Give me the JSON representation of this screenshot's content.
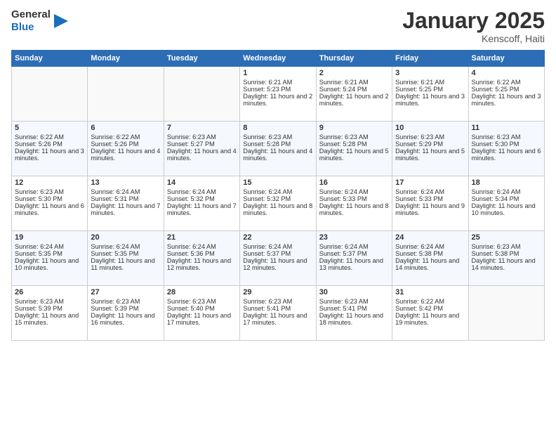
{
  "logo": {
    "general": "General",
    "blue": "Blue"
  },
  "title": "January 2025",
  "location": "Kenscoff, Haiti",
  "days_of_week": [
    "Sunday",
    "Monday",
    "Tuesday",
    "Wednesday",
    "Thursday",
    "Friday",
    "Saturday"
  ],
  "weeks": [
    [
      {
        "day": "",
        "info": ""
      },
      {
        "day": "",
        "info": ""
      },
      {
        "day": "",
        "info": ""
      },
      {
        "day": "1",
        "sunrise": "Sunrise: 6:21 AM",
        "sunset": "Sunset: 5:23 PM",
        "daylight": "Daylight: 11 hours and 2 minutes."
      },
      {
        "day": "2",
        "sunrise": "Sunrise: 6:21 AM",
        "sunset": "Sunset: 5:24 PM",
        "daylight": "Daylight: 11 hours and 2 minutes."
      },
      {
        "day": "3",
        "sunrise": "Sunrise: 6:21 AM",
        "sunset": "Sunset: 5:25 PM",
        "daylight": "Daylight: 11 hours and 3 minutes."
      },
      {
        "day": "4",
        "sunrise": "Sunrise: 6:22 AM",
        "sunset": "Sunset: 5:25 PM",
        "daylight": "Daylight: 11 hours and 3 minutes."
      }
    ],
    [
      {
        "day": "5",
        "sunrise": "Sunrise: 6:22 AM",
        "sunset": "Sunset: 5:26 PM",
        "daylight": "Daylight: 11 hours and 3 minutes."
      },
      {
        "day": "6",
        "sunrise": "Sunrise: 6:22 AM",
        "sunset": "Sunset: 5:26 PM",
        "daylight": "Daylight: 11 hours and 4 minutes."
      },
      {
        "day": "7",
        "sunrise": "Sunrise: 6:23 AM",
        "sunset": "Sunset: 5:27 PM",
        "daylight": "Daylight: 11 hours and 4 minutes."
      },
      {
        "day": "8",
        "sunrise": "Sunrise: 6:23 AM",
        "sunset": "Sunset: 5:28 PM",
        "daylight": "Daylight: 11 hours and 4 minutes."
      },
      {
        "day": "9",
        "sunrise": "Sunrise: 6:23 AM",
        "sunset": "Sunset: 5:28 PM",
        "daylight": "Daylight: 11 hours and 5 minutes."
      },
      {
        "day": "10",
        "sunrise": "Sunrise: 6:23 AM",
        "sunset": "Sunset: 5:29 PM",
        "daylight": "Daylight: 11 hours and 5 minutes."
      },
      {
        "day": "11",
        "sunrise": "Sunrise: 6:23 AM",
        "sunset": "Sunset: 5:30 PM",
        "daylight": "Daylight: 11 hours and 6 minutes."
      }
    ],
    [
      {
        "day": "12",
        "sunrise": "Sunrise: 6:23 AM",
        "sunset": "Sunset: 5:30 PM",
        "daylight": "Daylight: 11 hours and 6 minutes."
      },
      {
        "day": "13",
        "sunrise": "Sunrise: 6:24 AM",
        "sunset": "Sunset: 5:31 PM",
        "daylight": "Daylight: 11 hours and 7 minutes."
      },
      {
        "day": "14",
        "sunrise": "Sunrise: 6:24 AM",
        "sunset": "Sunset: 5:32 PM",
        "daylight": "Daylight: 11 hours and 7 minutes."
      },
      {
        "day": "15",
        "sunrise": "Sunrise: 6:24 AM",
        "sunset": "Sunset: 5:32 PM",
        "daylight": "Daylight: 11 hours and 8 minutes."
      },
      {
        "day": "16",
        "sunrise": "Sunrise: 6:24 AM",
        "sunset": "Sunset: 5:33 PM",
        "daylight": "Daylight: 11 hours and 8 minutes."
      },
      {
        "day": "17",
        "sunrise": "Sunrise: 6:24 AM",
        "sunset": "Sunset: 5:33 PM",
        "daylight": "Daylight: 11 hours and 9 minutes."
      },
      {
        "day": "18",
        "sunrise": "Sunrise: 6:24 AM",
        "sunset": "Sunset: 5:34 PM",
        "daylight": "Daylight: 11 hours and 10 minutes."
      }
    ],
    [
      {
        "day": "19",
        "sunrise": "Sunrise: 6:24 AM",
        "sunset": "Sunset: 5:35 PM",
        "daylight": "Daylight: 11 hours and 10 minutes."
      },
      {
        "day": "20",
        "sunrise": "Sunrise: 6:24 AM",
        "sunset": "Sunset: 5:35 PM",
        "daylight": "Daylight: 11 hours and 11 minutes."
      },
      {
        "day": "21",
        "sunrise": "Sunrise: 6:24 AM",
        "sunset": "Sunset: 5:36 PM",
        "daylight": "Daylight: 11 hours and 12 minutes."
      },
      {
        "day": "22",
        "sunrise": "Sunrise: 6:24 AM",
        "sunset": "Sunset: 5:37 PM",
        "daylight": "Daylight: 11 hours and 12 minutes."
      },
      {
        "day": "23",
        "sunrise": "Sunrise: 6:24 AM",
        "sunset": "Sunset: 5:37 PM",
        "daylight": "Daylight: 11 hours and 13 minutes."
      },
      {
        "day": "24",
        "sunrise": "Sunrise: 6:24 AM",
        "sunset": "Sunset: 5:38 PM",
        "daylight": "Daylight: 11 hours and 14 minutes."
      },
      {
        "day": "25",
        "sunrise": "Sunrise: 6:23 AM",
        "sunset": "Sunset: 5:38 PM",
        "daylight": "Daylight: 11 hours and 14 minutes."
      }
    ],
    [
      {
        "day": "26",
        "sunrise": "Sunrise: 6:23 AM",
        "sunset": "Sunset: 5:39 PM",
        "daylight": "Daylight: 11 hours and 15 minutes."
      },
      {
        "day": "27",
        "sunrise": "Sunrise: 6:23 AM",
        "sunset": "Sunset: 5:39 PM",
        "daylight": "Daylight: 11 hours and 16 minutes."
      },
      {
        "day": "28",
        "sunrise": "Sunrise: 6:23 AM",
        "sunset": "Sunset: 5:40 PM",
        "daylight": "Daylight: 11 hours and 17 minutes."
      },
      {
        "day": "29",
        "sunrise": "Sunrise: 6:23 AM",
        "sunset": "Sunset: 5:41 PM",
        "daylight": "Daylight: 11 hours and 17 minutes."
      },
      {
        "day": "30",
        "sunrise": "Sunrise: 6:23 AM",
        "sunset": "Sunset: 5:41 PM",
        "daylight": "Daylight: 11 hours and 18 minutes."
      },
      {
        "day": "31",
        "sunrise": "Sunrise: 6:22 AM",
        "sunset": "Sunset: 5:42 PM",
        "daylight": "Daylight: 11 hours and 19 minutes."
      },
      {
        "day": "",
        "info": ""
      }
    ]
  ]
}
